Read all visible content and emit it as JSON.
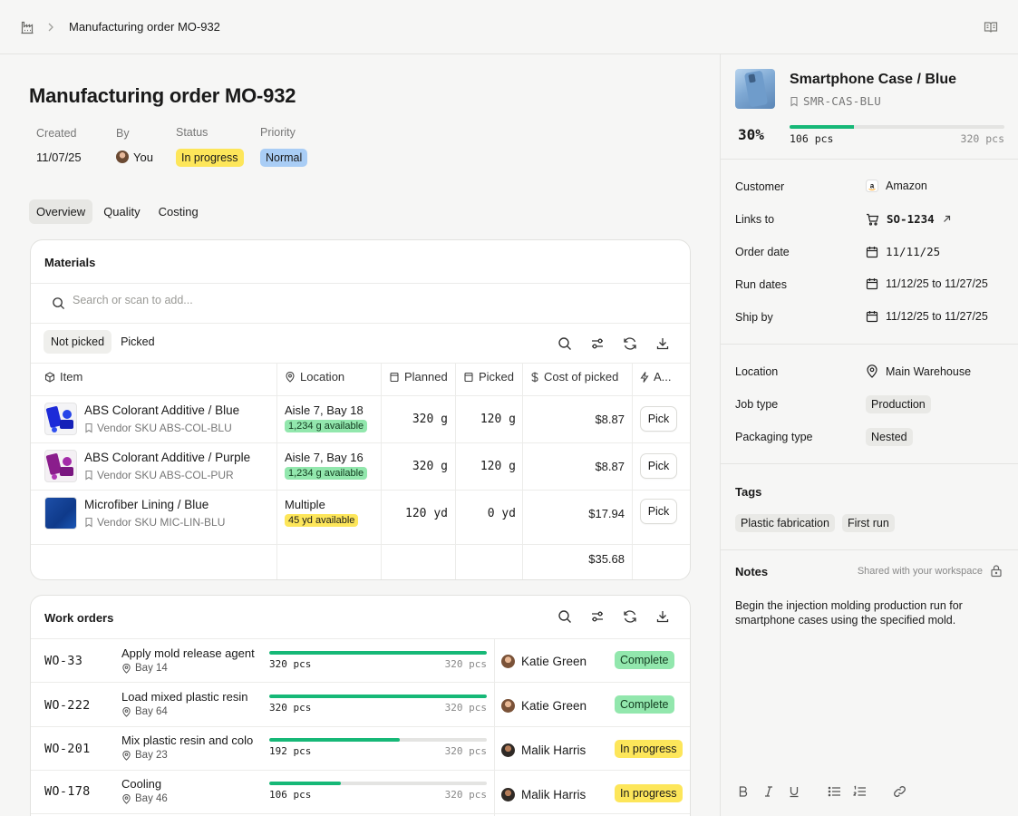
{
  "breadcrumb": {
    "current": "Manufacturing order MO-932"
  },
  "order": {
    "title": "Manufacturing order MO-932",
    "meta": {
      "created_label": "Created",
      "created_value": "11/07/25",
      "by_label": "By",
      "by_value": "You",
      "status_label": "Status",
      "status_value": "In progress",
      "priority_label": "Priority",
      "priority_value": "Normal"
    }
  },
  "tabs": [
    "Overview",
    "Quality",
    "Costing"
  ],
  "materials": {
    "title": "Materials",
    "search_placeholder": "Search or scan to add...",
    "subtabs": [
      "Not picked",
      "Picked"
    ],
    "columns": {
      "item": "Item",
      "location": "Location",
      "planned": "Planned",
      "picked": "Picked",
      "cost": "Cost of picked",
      "action": "A..."
    },
    "rows": [
      {
        "name": "ABS Colorant Additive / Blue",
        "sku": "Vendor SKU ABS-COL-BLU",
        "location": "Aisle 7, Bay 18",
        "available": "1,234 g available",
        "planned": "320 g",
        "picked": "120 g",
        "cost": "$8.87",
        "action": "Pick"
      },
      {
        "name": "ABS Colorant Additive / Purple",
        "sku": "Vendor SKU ABS-COL-PUR",
        "location": "Aisle 7, Bay 16",
        "available": "1,234 g available",
        "planned": "320 g",
        "picked": "120 g",
        "cost": "$8.87",
        "action": "Pick"
      },
      {
        "name": "Microfiber Lining / Blue",
        "sku": "Vendor SKU MIC-LIN-BLU",
        "location": "Multiple",
        "available": "45 yd available",
        "planned": "120 yd",
        "picked": "0 yd",
        "cost": "$17.94",
        "action": "Pick"
      }
    ],
    "total_cost": "$35.68"
  },
  "work_orders": {
    "title": "Work orders",
    "rows": [
      {
        "id": "WO-33",
        "name": "Apply mold release agent",
        "bay": "Bay 14",
        "done": "320 pcs",
        "total": "320 pcs",
        "progress": 1.0,
        "assignee": "Katie Green",
        "status": "Complete"
      },
      {
        "id": "WO-222",
        "name": "Load mixed plastic resin",
        "bay": "Bay 64",
        "done": "320 pcs",
        "total": "320 pcs",
        "progress": 1.0,
        "assignee": "Katie Green",
        "status": "Complete"
      },
      {
        "id": "WO-201",
        "name": "Mix plastic resin and colo",
        "bay": "Bay 23",
        "done": "192 pcs",
        "total": "320 pcs",
        "progress": 0.6,
        "assignee": "Malik Harris",
        "status": "In progress"
      },
      {
        "id": "WO-178",
        "name": "Cooling",
        "bay": "Bay 46",
        "done": "106 pcs",
        "total": "320 pcs",
        "progress": 0.33,
        "assignee": "Malik Harris",
        "status": "In progress"
      }
    ]
  },
  "product": {
    "title": "Smartphone Case / Blue",
    "sku": "SMR-CAS-BLU",
    "percent": "30%",
    "progress": 0.3,
    "done": "106 pcs",
    "total": "320 pcs"
  },
  "details": {
    "customer_label": "Customer",
    "customer_value": "Amazon",
    "links_label": "Links to",
    "links_value": "SO-1234",
    "order_date_label": "Order date",
    "order_date_value": "11/11/25",
    "run_dates_label": "Run dates",
    "run_dates_value": "11/12/25 to 11/27/25",
    "ship_by_label": "Ship by",
    "ship_by_value": "11/12/25 to 11/27/25",
    "location_label": "Location",
    "location_value": "Main Warehouse",
    "job_type_label": "Job type",
    "job_type_value": "Production",
    "packaging_label": "Packaging type",
    "packaging_value": "Nested"
  },
  "tags": {
    "title": "Tags",
    "items": [
      "Plastic fabrication",
      "First run"
    ]
  },
  "notes": {
    "title": "Notes",
    "hint": "Shared with your workspace",
    "text": "Begin the injection molding production run for smartphone cases using the specified mold."
  },
  "colors": {
    "accent_green": "#16b877",
    "status_yellow": "#fde65a",
    "status_blue": "#a9cdf5",
    "status_green": "#92e7ad"
  },
  "icons": [
    "factory-icon",
    "chevron-right-icon",
    "book-icon",
    "search-icon",
    "sliders-icon",
    "refresh-icon",
    "download-icon",
    "box-icon",
    "map-pin-icon",
    "file-icon",
    "dollar-icon",
    "bolt-icon",
    "bookmark-icon",
    "cart-icon",
    "arrow-up-right-icon",
    "calendar-icon",
    "lock-icon",
    "bold-icon",
    "italic-icon",
    "underline-icon",
    "bullet-list-icon",
    "numbered-list-icon",
    "link-icon"
  ]
}
